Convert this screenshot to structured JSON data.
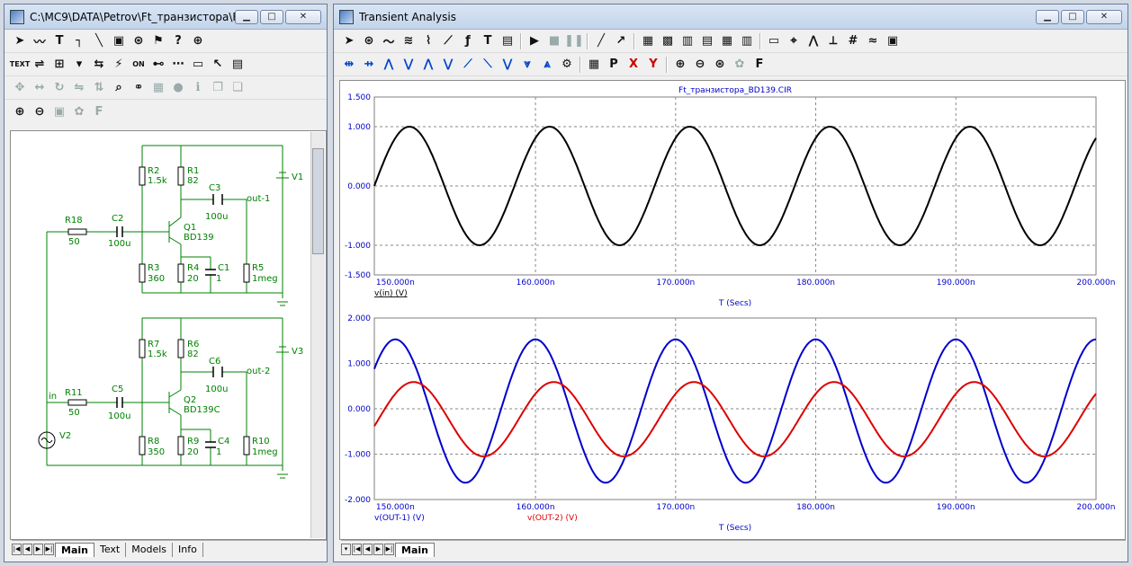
{
  "schematic_window": {
    "title": "C:\\MC9\\DATA\\Petrov\\Ft_транзистора\\Ft_...",
    "tabs": [
      "Main",
      "Text",
      "Models",
      "Info"
    ],
    "components": {
      "top": {
        "R18": "R18",
        "R18v": "50",
        "C2": "C2",
        "C2v": "100u",
        "R2": "R2",
        "R2v": "1.5k",
        "R1": "R1",
        "R1v": "82",
        "C3": "C3",
        "C3v": "100u",
        "Q1": "Q1",
        "Q1v": "BD139",
        "R3": "R3",
        "R3v": "360",
        "R4": "R4",
        "R4v": "20",
        "C1": "C1",
        "C1v": "1",
        "R5": "R5",
        "R5v": "1meg",
        "V1": "V1",
        "out": "out-1"
      },
      "bottom": {
        "R11": "R11",
        "R11v": "50",
        "C5": "C5",
        "C5v": "100u",
        "R7": "R7",
        "R7v": "1.5k",
        "R6": "R6",
        "R6v": "82",
        "C6": "C6",
        "C6v": "100u",
        "Q2": "Q2",
        "Q2v": "BD139C",
        "R8": "R8",
        "R8v": "350",
        "R9": "R9",
        "R9v": "20",
        "C4": "C4",
        "C4v": "1",
        "R10": "R10",
        "R10v": "1meg",
        "V3": "V3",
        "V2": "V2",
        "in": "in",
        "out": "out-2"
      }
    }
  },
  "analysis_window": {
    "title": "Transient Analysis",
    "tabs": [
      "Main"
    ]
  },
  "colors": {
    "black_trace": "#000000",
    "blue_trace": "#0000cc",
    "red_trace": "#dd0000",
    "axis_text": "#0000cc"
  },
  "chart_data": [
    {
      "type": "line",
      "title": "Ft_транзистора_BD139.CIR",
      "xlabel": "T (Secs)",
      "xlim": [
        148.5,
        200
      ],
      "ylim": [
        -1.5,
        1.5
      ],
      "x_ticks": [
        "150.000n",
        "160.000n",
        "170.000n",
        "180.000n",
        "190.000n",
        "200.000n"
      ],
      "y_ticks": [
        "1.500",
        "1.000",
        "0.000",
        "-1.000",
        "-1.500"
      ],
      "grid": true,
      "series": [
        {
          "name": "v(in) (V)",
          "color": "#000000",
          "amplitude": 1.0,
          "period_ns": 10.0,
          "phase_ns": 148.5,
          "offset": 0.0
        }
      ]
    },
    {
      "type": "line",
      "xlabel": "T (Secs)",
      "xlim": [
        148.5,
        200
      ],
      "ylim": [
        -2.0,
        2.0
      ],
      "x_ticks": [
        "150.000n",
        "160.000n",
        "170.000n",
        "180.000n",
        "190.000n",
        "200.000n"
      ],
      "y_ticks": [
        "2.000",
        "1.000",
        "0.000",
        "-1.000",
        "-2.000"
      ],
      "grid": true,
      "series": [
        {
          "name": "v(OUT-1) (V)",
          "color": "#0000cc",
          "amplitude": 1.58,
          "period_ns": 10.0,
          "peak_ns": 150.0,
          "offset": -0.05
        },
        {
          "name": "v(OUT-2) (V)",
          "color": "#dd0000",
          "amplitude": 0.82,
          "period_ns": 10.0,
          "peak_ns": 151.3,
          "offset": -0.23
        }
      ]
    }
  ]
}
